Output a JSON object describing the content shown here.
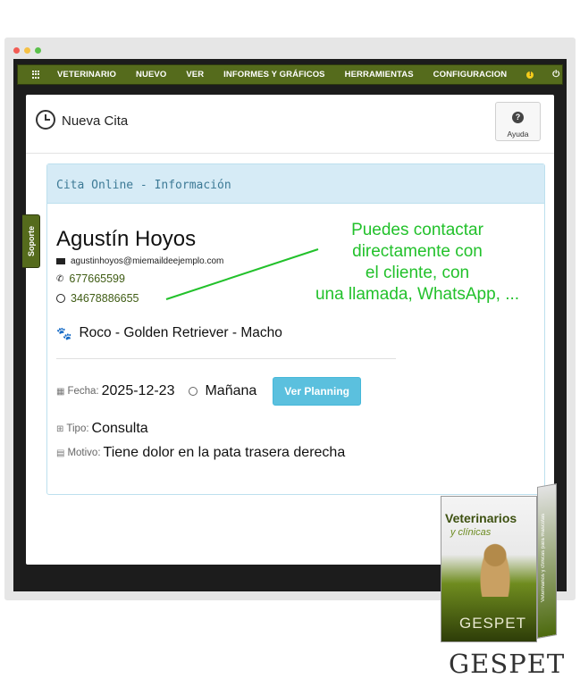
{
  "nav": {
    "items": [
      "VETERINARIO",
      "NUEVO",
      "VER",
      "INFORMES Y GRÁFICOS",
      "HERRAMIENTAS",
      "CONFIGURACION"
    ]
  },
  "page": {
    "title": "Nueva Cita",
    "help_label": "Ayuda",
    "support_tab": "Soporte"
  },
  "card": {
    "title": "Cita Online - Información",
    "client_name": "Agustín Hoyos",
    "email": "agustinhoyos@miemaildeejemplo.com",
    "phone": "677665599",
    "whatsapp": "34678886655",
    "pet": "Roco - Golden Retriever - Macho",
    "date_label": "Fecha:",
    "date_value": "2025-12-23",
    "time_value": "Mañana",
    "planning_button": "Ver Planning",
    "type_label": "Tipo:",
    "type_value": "Consulta",
    "reason_label": "Motivo:",
    "reason_value": "Tiene dolor en la pata trasera derecha"
  },
  "annotation": {
    "lines": [
      "Puedes contactar",
      "directamente con",
      "el cliente, con",
      "una llamada, WhatsApp, ..."
    ]
  },
  "product": {
    "title1": "Veterinarios",
    "title2": "y clínicas",
    "brand": "GESPET",
    "side_text": "Veterinarios y clínicas para mascotas",
    "logo": "GESPET"
  },
  "colors": {
    "nav_bg": "#556b1c",
    "card_head_bg": "#d6ebf6",
    "accent_green": "#22c12b",
    "button_blue": "#5bc0de"
  }
}
